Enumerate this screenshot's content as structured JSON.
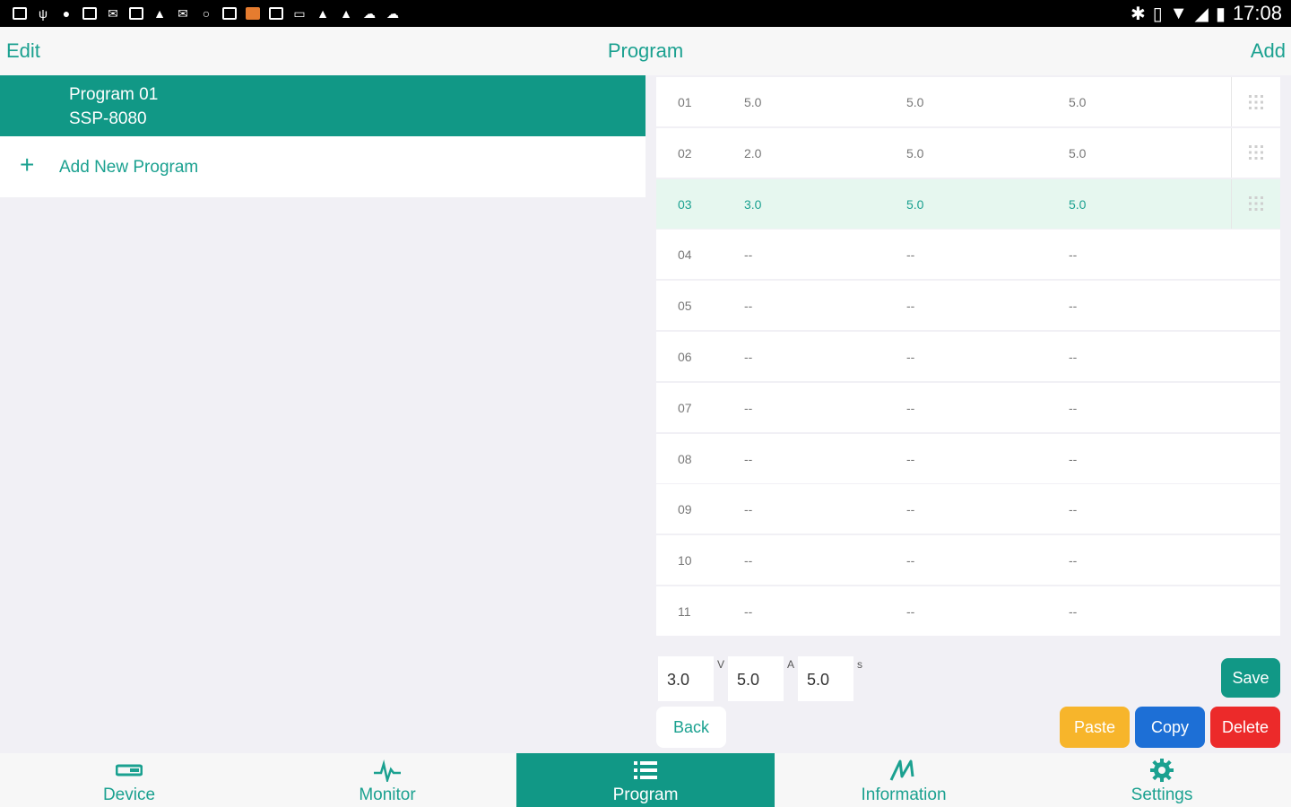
{
  "statusbar": {
    "time": "17:08",
    "icons": [
      "notification-icon",
      "usb-icon",
      "chat-icon",
      "image-icon",
      "mail-icon",
      "calendar-icon",
      "warning-icon",
      "mail-icon",
      "sync-icon",
      "app-icon",
      "orange-app-icon",
      "doc-icon",
      "message-icon",
      "warning-icon",
      "warning-icon",
      "cloud-icon",
      "cloud-icon"
    ],
    "right_icons": [
      "bluetooth-icon",
      "vibrate-icon",
      "wifi-icon",
      "signal-icon",
      "battery-icon"
    ]
  },
  "topbar": {
    "edit": "Edit",
    "title": "Program",
    "add": "Add"
  },
  "left": {
    "selected": {
      "name": "Program 01",
      "model": "SSP-8080"
    },
    "add_label": "Add New Program"
  },
  "table": {
    "rows": [
      {
        "num": "01",
        "v": "5.0",
        "a": "5.0",
        "s": "5.0",
        "handle": true
      },
      {
        "num": "02",
        "v": "2.0",
        "a": "5.0",
        "s": "5.0",
        "handle": true
      },
      {
        "num": "03",
        "v": "3.0",
        "a": "5.0",
        "s": "5.0",
        "handle": true,
        "active": true
      },
      {
        "num": "04",
        "v": "--",
        "a": "--",
        "s": "--"
      },
      {
        "num": "05",
        "v": "--",
        "a": "--",
        "s": "--"
      },
      {
        "num": "06",
        "v": "--",
        "a": "--",
        "s": "--"
      },
      {
        "num": "07",
        "v": "--",
        "a": "--",
        "s": "--"
      },
      {
        "num": "08",
        "v": "--",
        "a": "--",
        "s": "--"
      },
      {
        "num": "09",
        "v": "--",
        "a": "--",
        "s": "--"
      },
      {
        "num": "10",
        "v": "--",
        "a": "--",
        "s": "--"
      },
      {
        "num": "11",
        "v": "--",
        "a": "--",
        "s": "--"
      }
    ]
  },
  "editor": {
    "voltage": "3.0",
    "voltage_unit": "V",
    "current": "5.0",
    "current_unit": "A",
    "time": "5.0",
    "time_unit": "s",
    "save": "Save",
    "back": "Back",
    "paste": "Paste",
    "copy": "Copy",
    "delete": "Delete"
  },
  "nav": {
    "items": [
      {
        "label": "Device",
        "icon": "device-icon"
      },
      {
        "label": "Monitor",
        "icon": "monitor-icon"
      },
      {
        "label": "Program",
        "icon": "list-icon",
        "active": true
      },
      {
        "label": "Information",
        "icon": "information-icon"
      },
      {
        "label": "Settings",
        "icon": "gear-icon"
      }
    ]
  },
  "colors": {
    "accent": "#119886",
    "accent_text": "#1ba190",
    "paste": "#f7b52b",
    "copy": "#1d6fd6",
    "delete": "#ec2a2a"
  }
}
